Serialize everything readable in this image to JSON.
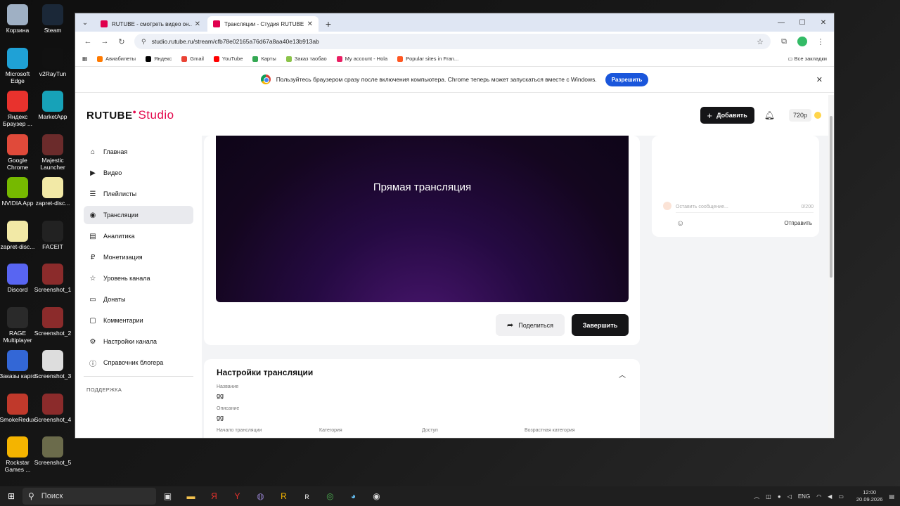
{
  "desktop": {
    "icons_left": [
      {
        "label": "Корзина",
        "icon": "recycle-bin-icon",
        "color": "#9fb0c4"
      },
      {
        "label": "Microsoft Edge",
        "icon": "edge-icon",
        "color": "#1fa1d6"
      },
      {
        "label": "Яндекс Браузер ...",
        "icon": "yandex-browser-icon",
        "color": "#e8322d"
      },
      {
        "label": "Google Chrome",
        "icon": "chrome-icon",
        "color": "#e04a3a"
      },
      {
        "label": "NVIDIA App",
        "icon": "nvidia-icon",
        "color": "#76b900"
      },
      {
        "label": "zapret-disc...",
        "icon": "file-icon",
        "color": "#f2e9a6"
      },
      {
        "label": "Discord",
        "icon": "discord-icon",
        "color": "#5865f2"
      },
      {
        "label": "RAGE Multiplayer",
        "icon": "rage-icon",
        "color": "#2a2a2a"
      },
      {
        "label": "Заказы карго",
        "icon": "document-icon",
        "color": "#3367d6"
      },
      {
        "label": "SmokeRedux",
        "icon": "smoke-icon",
        "color": "#c0392b"
      },
      {
        "label": "Rockstar Games ...",
        "icon": "rockstar-icon",
        "color": "#f4b400"
      }
    ],
    "icons_right": [
      {
        "label": "Steam",
        "icon": "steam-icon",
        "color": "#1b2838"
      },
      {
        "label": "v2RayTun",
        "icon": "v2ray-icon",
        "color": "#111111"
      },
      {
        "label": "MarketApp",
        "icon": "marketapp-icon",
        "color": "#17a2b8"
      },
      {
        "label": "Majestic Launcher",
        "icon": "majestic-icon",
        "color": "#6b2b2b"
      },
      {
        "label": "zapret-disc...",
        "icon": "file-icon",
        "color": "#f2e9a6"
      },
      {
        "label": "FACEIT",
        "icon": "faceit-icon",
        "color": "#222222"
      },
      {
        "label": "Screenshot_1",
        "icon": "image-icon",
        "color": "#8b2b2b"
      },
      {
        "label": "Screenshot_2",
        "icon": "image-icon",
        "color": "#8b2b2b"
      },
      {
        "label": "Screenshot_3",
        "icon": "image-icon",
        "color": "#dddddd"
      },
      {
        "label": "Screenshot_4",
        "icon": "image-icon",
        "color": "#8b2b2b"
      },
      {
        "label": "Screenshot_5",
        "icon": "image-icon",
        "color": "#6b6b4b"
      }
    ]
  },
  "browser": {
    "tabs": [
      {
        "title": "RUTUBE - смотреть видео он...",
        "active": false
      },
      {
        "title": "Трансляции - Студия RUTUBE",
        "active": true
      }
    ],
    "url": "studio.rutube.ru/stream/cfb78e02165a76d67a8aa40e13b913ab",
    "bookmarks": [
      {
        "label": "Авиабилеты",
        "color": "#ff7a00"
      },
      {
        "label": "Яндекс",
        "color": "#000000"
      },
      {
        "label": "Gmail",
        "color": "#ea4335"
      },
      {
        "label": "YouTube",
        "color": "#ff0000"
      },
      {
        "label": "Карты",
        "color": "#34a853"
      },
      {
        "label": "Заказ таобао",
        "color": "#8bc34a"
      },
      {
        "label": "My account - Hola",
        "color": "#e91e63"
      },
      {
        "label": "Popular sites in Fran...",
        "color": "#ff5722"
      }
    ],
    "all_bookmarks": "Все закладки",
    "infobar": {
      "text": "Пользуйтесь браузером сразу после включения компьютера. Chrome теперь может запускаться вместе с Windows.",
      "button": "Разрешить"
    }
  },
  "app": {
    "logo_main": "RUTUBE",
    "logo_sub": "Studio",
    "header": {
      "add_label": "Добавить",
      "resolution": "720p"
    },
    "nav": [
      {
        "label": "Главная",
        "icon": "home-icon",
        "glyph": "⌂"
      },
      {
        "label": "Видео",
        "icon": "video-icon",
        "glyph": "▶"
      },
      {
        "label": "Плейлисты",
        "icon": "playlist-icon",
        "glyph": "☰"
      },
      {
        "label": "Трансляции",
        "icon": "broadcast-icon",
        "glyph": "◉",
        "active": true
      },
      {
        "label": "Аналитика",
        "icon": "analytics-icon",
        "glyph": "▤"
      },
      {
        "label": "Монетизация",
        "icon": "monetization-icon",
        "glyph": "₽"
      },
      {
        "label": "Уровень канала",
        "icon": "star-icon",
        "glyph": "☆"
      },
      {
        "label": "Донаты",
        "icon": "donate-icon",
        "glyph": "▭"
      },
      {
        "label": "Комментарии",
        "icon": "comments-icon",
        "glyph": "▢"
      },
      {
        "label": "Настройки канала",
        "icon": "settings-icon",
        "glyph": "⚙"
      },
      {
        "label": "Справочник блогера",
        "icon": "info-icon",
        "glyph": "ⓘ"
      }
    ],
    "support_label": "ПОДДЕРЖКА",
    "player": {
      "title": "Прямая трансляция",
      "share_label": "Поделиться",
      "end_label": "Завершить"
    },
    "settings": {
      "title": "Настройки трансляции",
      "name_label": "Название",
      "name_value": "gg",
      "desc_label": "Описание",
      "desc_value": "gg",
      "row_labels": [
        "Начало трансляции",
        "Категория",
        "Доступ",
        "Возрастная категория"
      ]
    },
    "chat": {
      "placeholder": "Оставить сообщение...",
      "counter": "0/200",
      "send_label": "Отправить"
    }
  },
  "taskbar": {
    "search_label": "Поиск",
    "lang": "ENG",
    "time": "12:00",
    "date": "20.09.2026"
  }
}
